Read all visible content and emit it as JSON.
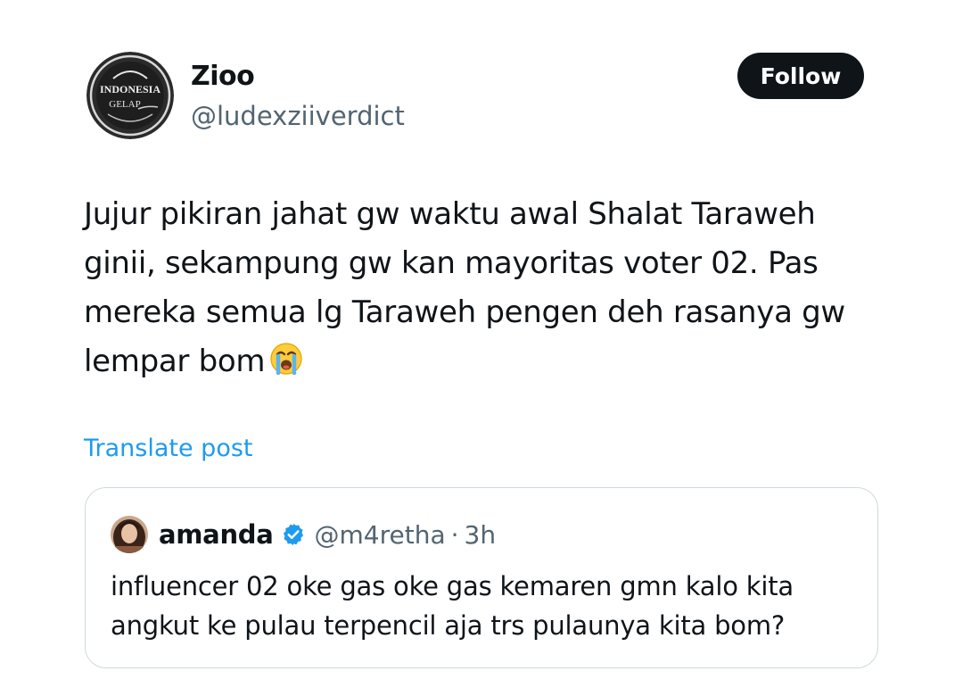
{
  "author": {
    "display_name": "Zioo",
    "handle": "@ludexziiverdict",
    "avatar_icon": "indonesia-gelap-logo-avatar",
    "avatar_logo_text": [
      "INDONESIA",
      "GELAP"
    ]
  },
  "follow_button": {
    "label": "Follow"
  },
  "post": {
    "text": "Jujur pikiran jahat gw waktu awal Shalat Taraweh\nginii, sekampung gw kan mayoritas voter 02. Pas\nmereka semua lg Taraweh pengen deh rasanya gw\nlempar bom",
    "emoji": "loudly-crying-face-icon"
  },
  "translate": {
    "label": "Translate post"
  },
  "quoted_post": {
    "display_name": "amanda",
    "verified": true,
    "verified_icon": "verified-badge-icon",
    "handle": "@m4retha",
    "separator": "·",
    "time": "3h",
    "text": "influencer 02 oke gas oke gas kemaren gmn kalo kita\nangkut ke pulau terpencil aja trs pulaunya kita bom?"
  },
  "colors": {
    "text_primary": "#0f1419",
    "text_secondary": "#536471",
    "link_blue": "#1d9bf0",
    "follow_bg": "#0f1419",
    "border": "#cfd9de"
  }
}
